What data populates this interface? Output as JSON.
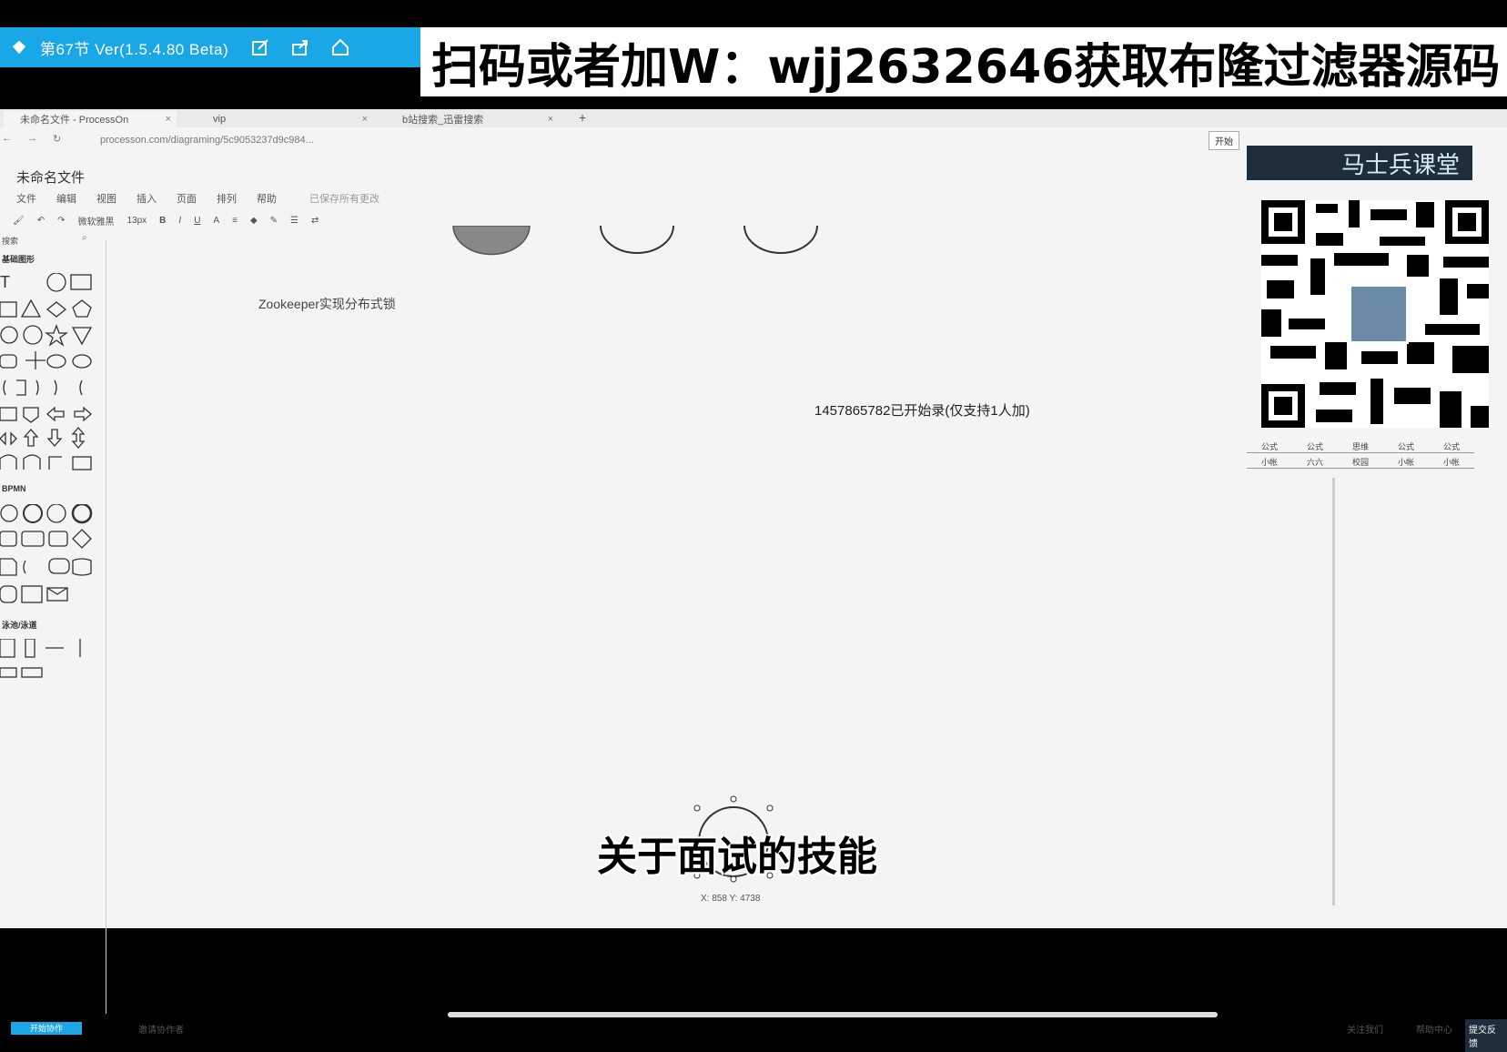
{
  "player": {
    "title": "第67节 Ver(1.5.4.80 Beta)",
    "icons": [
      "app-logo-icon",
      "edit-icon",
      "share-icon",
      "home-icon"
    ]
  },
  "banner": {
    "text": "扫码或者加W：wjj2632646获取布隆过滤器源码"
  },
  "browser": {
    "tabs": [
      {
        "label": "未命名文件 - ProcessOn",
        "close": "×"
      },
      {
        "label": "vip",
        "close": "×"
      },
      {
        "label": "b站搜索_迅雷搜索",
        "close": "×"
      }
    ],
    "new_tab": "+",
    "address": "processon.com/diagraming/5c9053237d9c984..."
  },
  "app": {
    "file_name": "未命名文件",
    "menu": [
      "文件",
      "编辑",
      "视图",
      "插入",
      "页面",
      "排列",
      "帮助"
    ],
    "menu_extra": "已保存所有更改",
    "toolbar": {
      "font": "微软雅黑",
      "size": "13px"
    },
    "search_placeholder": "搜索",
    "panel_sections": [
      "基础图形",
      "BPMN",
      "泳池/泳道"
    ]
  },
  "canvas": {
    "text1": "Zookeeper实现分布式锁",
    "text2": "1457865782已开始录(仅支持1人加)",
    "coords": "X: 858  Y: 4738"
  },
  "caption": "关于面试的技能",
  "right": {
    "brand": "马士兵课堂",
    "row1": [
      "公式",
      "公式",
      "思维",
      "公式",
      "公式"
    ],
    "row2": [
      "小帐",
      "六六",
      "校园",
      "小帐",
      "小帐"
    ],
    "top_btn": "开始"
  },
  "status": {
    "left_btn": "开始协作",
    "collab": "邀请协作者",
    "right": [
      "关注我们",
      "帮助中心",
      "提交反馈"
    ]
  }
}
